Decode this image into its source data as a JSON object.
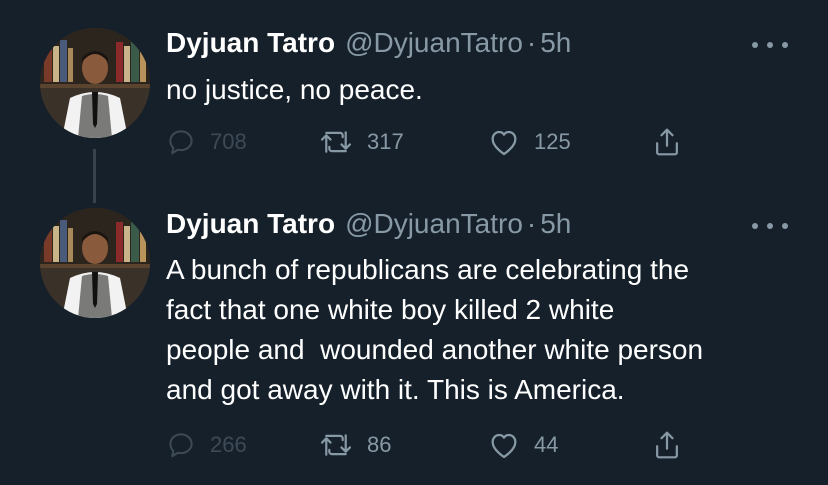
{
  "colors": {
    "background": "#15202b",
    "primary_text": "#ffffff",
    "secondary_text": "#8899a6",
    "thread_line": "#38444d"
  },
  "tweets": [
    {
      "display_name": "Dyjuan Tatro",
      "handle": "@DyjuanTatro",
      "separator": "·",
      "time": "5h",
      "text": "no justice, no peace.",
      "replies": "708",
      "retweets": "317",
      "likes": "125",
      "icons": [
        "avatar-photo",
        "more-icon",
        "reply-icon",
        "retweet-icon",
        "like-icon",
        "share-icon"
      ]
    },
    {
      "display_name": "Dyjuan Tatro",
      "handle": "@DyjuanTatro",
      "separator": "·",
      "time": "5h",
      "text": "A bunch of republicans are celebrating the\nfact that one white boy killed 2 white\npeople and  wounded another white person\nand got away with it. This is America.",
      "replies": "266",
      "retweets": "86",
      "likes": "44",
      "icons": [
        "avatar-photo",
        "more-icon",
        "reply-icon",
        "retweet-icon",
        "like-icon",
        "share-icon"
      ]
    }
  ]
}
